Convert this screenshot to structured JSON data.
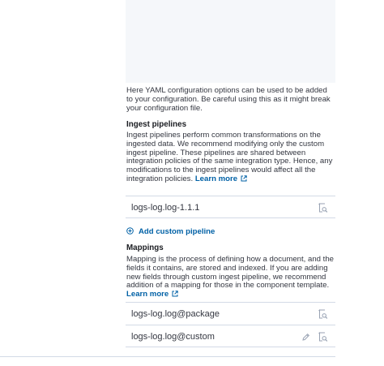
{
  "yaml": {
    "help": "Here YAML configuration options can be used to be added to your configuration. Be careful using this as it might break your configuration file."
  },
  "ingest": {
    "title": "Ingest pipelines",
    "description": "Ingest pipelines perform common transformations on the ingested data. We recommend modifying only the custom ingest pipeline. These pipelines are shared between integration policies of the same integration type. Hence, any modifications to the ingest pipelines would affect all the integration policies.",
    "learn_more": "Learn more",
    "pipelines": [
      {
        "name": "logs-log.log-1.1.1"
      }
    ],
    "add_label": "Add custom pipeline"
  },
  "mappings": {
    "title": "Mappings",
    "description": "Mapping is the process of defining how a document, and the fields it contains, are stored and indexed. If you are adding new fields through custom ingest pipeline, we recommend addition of a mapping for those in the component template.",
    "learn_more": "Learn more",
    "templates": [
      {
        "name": "logs-log.log@package"
      },
      {
        "name": "logs-log.log@custom"
      }
    ]
  },
  "colors": {
    "link": "#0061a6",
    "border": "#d3dae6",
    "editor_bg": "#f5f7fa",
    "icon": "#98a2b3"
  },
  "icons": [
    "external-link-icon",
    "inspect-icon",
    "plus-in-circle-icon",
    "pencil-icon"
  ]
}
